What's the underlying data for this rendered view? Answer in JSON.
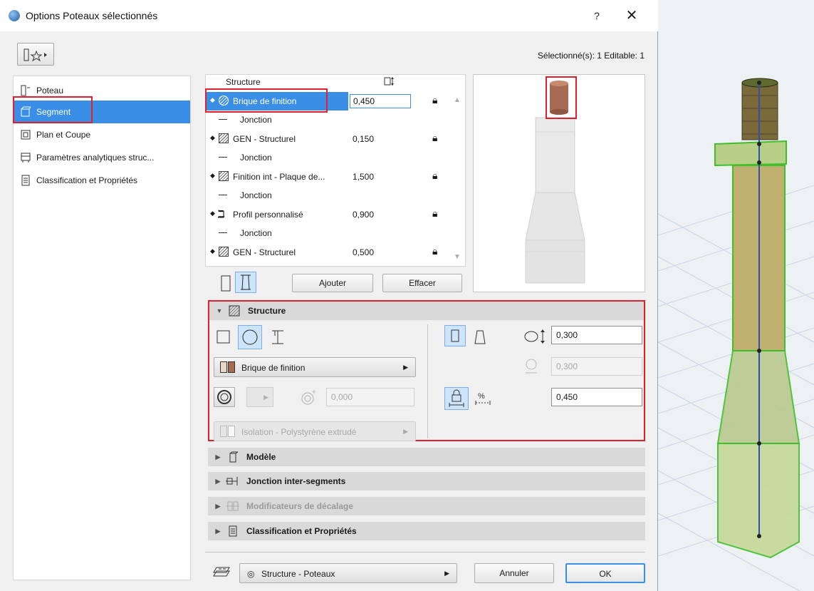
{
  "window": {
    "title": "Options Poteaux sélectionnés",
    "help": "?",
    "close": "✕",
    "selection_info": "Sélectionné(s): 1 Editable: 1"
  },
  "nav": {
    "items": [
      {
        "label": "Poteau",
        "icon": "column-icon"
      },
      {
        "label": "Segment",
        "icon": "segment-icon",
        "active": true
      },
      {
        "label": "Plan et Coupe",
        "icon": "floor-plan-icon"
      },
      {
        "label": "Paramètres analytiques struc...",
        "icon": "analytic-icon"
      },
      {
        "label": "Classification et Propriétés",
        "icon": "classification-icon"
      }
    ]
  },
  "structure_table": {
    "col_name": "Structure",
    "rows": [
      {
        "kind": "segment",
        "icon": "circle-hatch-icon",
        "name": "Brique de finition",
        "value": "0,450",
        "selected": true
      },
      {
        "kind": "joint",
        "name": "Jonction"
      },
      {
        "kind": "segment",
        "icon": "hatch-icon",
        "name": "GEN - Structurel",
        "value": "0,150"
      },
      {
        "kind": "joint",
        "name": "Jonction"
      },
      {
        "kind": "segment",
        "icon": "hatch-icon",
        "name": "Finition int - Plaque de...",
        "value": "1,500"
      },
      {
        "kind": "joint",
        "name": "Jonction"
      },
      {
        "kind": "segment",
        "icon": "profile-icon",
        "name": "Profil personnalisé",
        "value": "0,900"
      },
      {
        "kind": "joint",
        "name": "Jonction"
      },
      {
        "kind": "segment",
        "icon": "hatch-icon",
        "name": "GEN - Structurel",
        "value": "0,500"
      }
    ],
    "add_label": "Ajouter",
    "delete_label": "Effacer"
  },
  "structure_panel": {
    "title": "Structure",
    "material": "Brique de finition",
    "material_colors": [
      "#e8d6c6",
      "#a86a52"
    ],
    "core_offset": "0,000",
    "insulation": "Isolation - Polystyrène extrudé",
    "width": "0,300",
    "depth": "0,300",
    "length": "0,450"
  },
  "sections": [
    {
      "title": "Modèle",
      "icon": "model-icon",
      "enabled": true
    },
    {
      "title": "Jonction inter-segments",
      "icon": "junction-icon",
      "enabled": true
    },
    {
      "title": "Modificateurs de décalage",
      "icon": "offset-icon",
      "enabled": false
    },
    {
      "title": "Classification et Propriétés",
      "icon": "classification-icon",
      "enabled": true
    }
  ],
  "footer": {
    "layer": "Structure - Poteaux",
    "cancel_label": "Annuler",
    "ok_label": "OK"
  },
  "colors": {
    "accent": "#3a8ee6",
    "highlight": "#e0202a",
    "brick": "#a86a52"
  }
}
